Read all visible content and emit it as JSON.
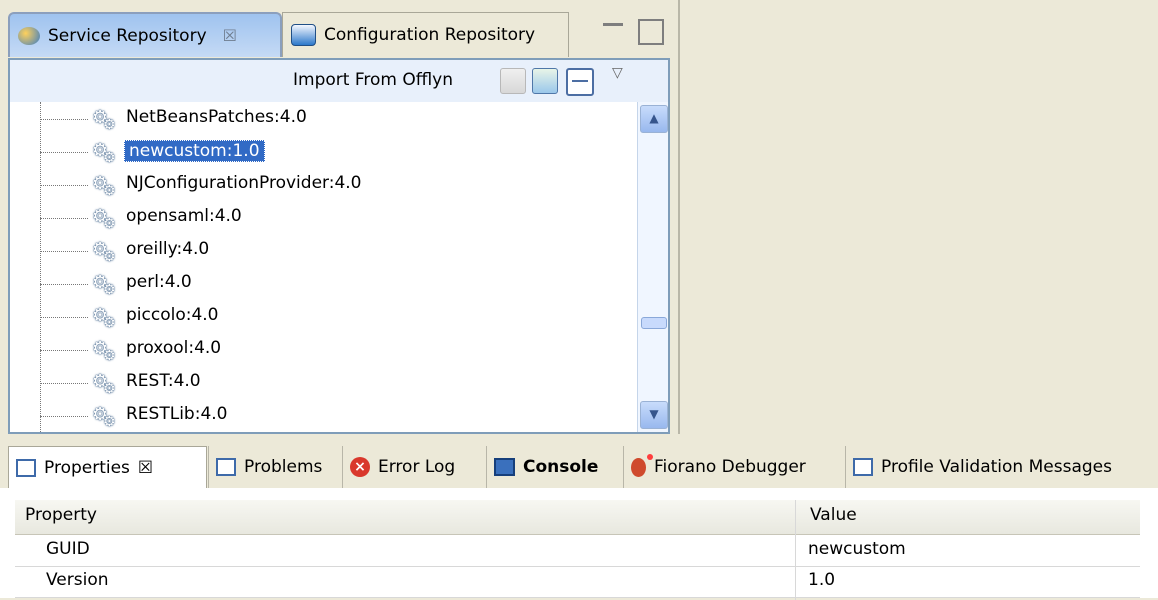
{
  "top_view": {
    "tabs": [
      {
        "label": "Service Repository",
        "active": true,
        "icon": "service-repository-icon"
      },
      {
        "label": "Configuration Repository",
        "active": false,
        "icon": "configuration-repository-icon"
      }
    ],
    "toolbar": {
      "import_label": "Import From Offlyn",
      "icons": [
        "import-icon",
        "refresh-icon",
        "collapse-all-icon",
        "view-menu-icon"
      ]
    },
    "tree_items": [
      {
        "label": "NetBeansPatches:4.0",
        "selected": false
      },
      {
        "label": "newcustom:1.0",
        "selected": true
      },
      {
        "label": "NJConfigurationProvider:4.0",
        "selected": false
      },
      {
        "label": "opensaml:4.0",
        "selected": false
      },
      {
        "label": "oreilly:4.0",
        "selected": false
      },
      {
        "label": "perl:4.0",
        "selected": false
      },
      {
        "label": "piccolo:4.0",
        "selected": false
      },
      {
        "label": "proxool:4.0",
        "selected": false
      },
      {
        "label": "REST:4.0",
        "selected": false
      },
      {
        "label": "RESTLib:4.0",
        "selected": false
      }
    ],
    "scrollbar": {
      "position": 0.66
    }
  },
  "bottom_view": {
    "tabs": [
      {
        "label": "Properties",
        "active": true,
        "icon": "properties-icon"
      },
      {
        "label": "Problems",
        "active": false,
        "icon": "problems-icon"
      },
      {
        "label": "Error Log",
        "active": false,
        "icon": "error-log-icon"
      },
      {
        "label": "Console",
        "active": false,
        "icon": "console-icon"
      },
      {
        "label": "Fiorano Debugger",
        "active": false,
        "icon": "debugger-icon"
      },
      {
        "label": "Profile Validation Messages",
        "active": false,
        "icon": "validation-messages-icon"
      }
    ],
    "table": {
      "headers": [
        "Property",
        "Value"
      ],
      "rows": [
        {
          "property": "GUID",
          "value": "newcustom"
        },
        {
          "property": "Version",
          "value": "1.0"
        }
      ]
    }
  },
  "colors": {
    "selection": "#316ac5",
    "active_tab": "#c5daf5",
    "background": "#ece9d8"
  }
}
